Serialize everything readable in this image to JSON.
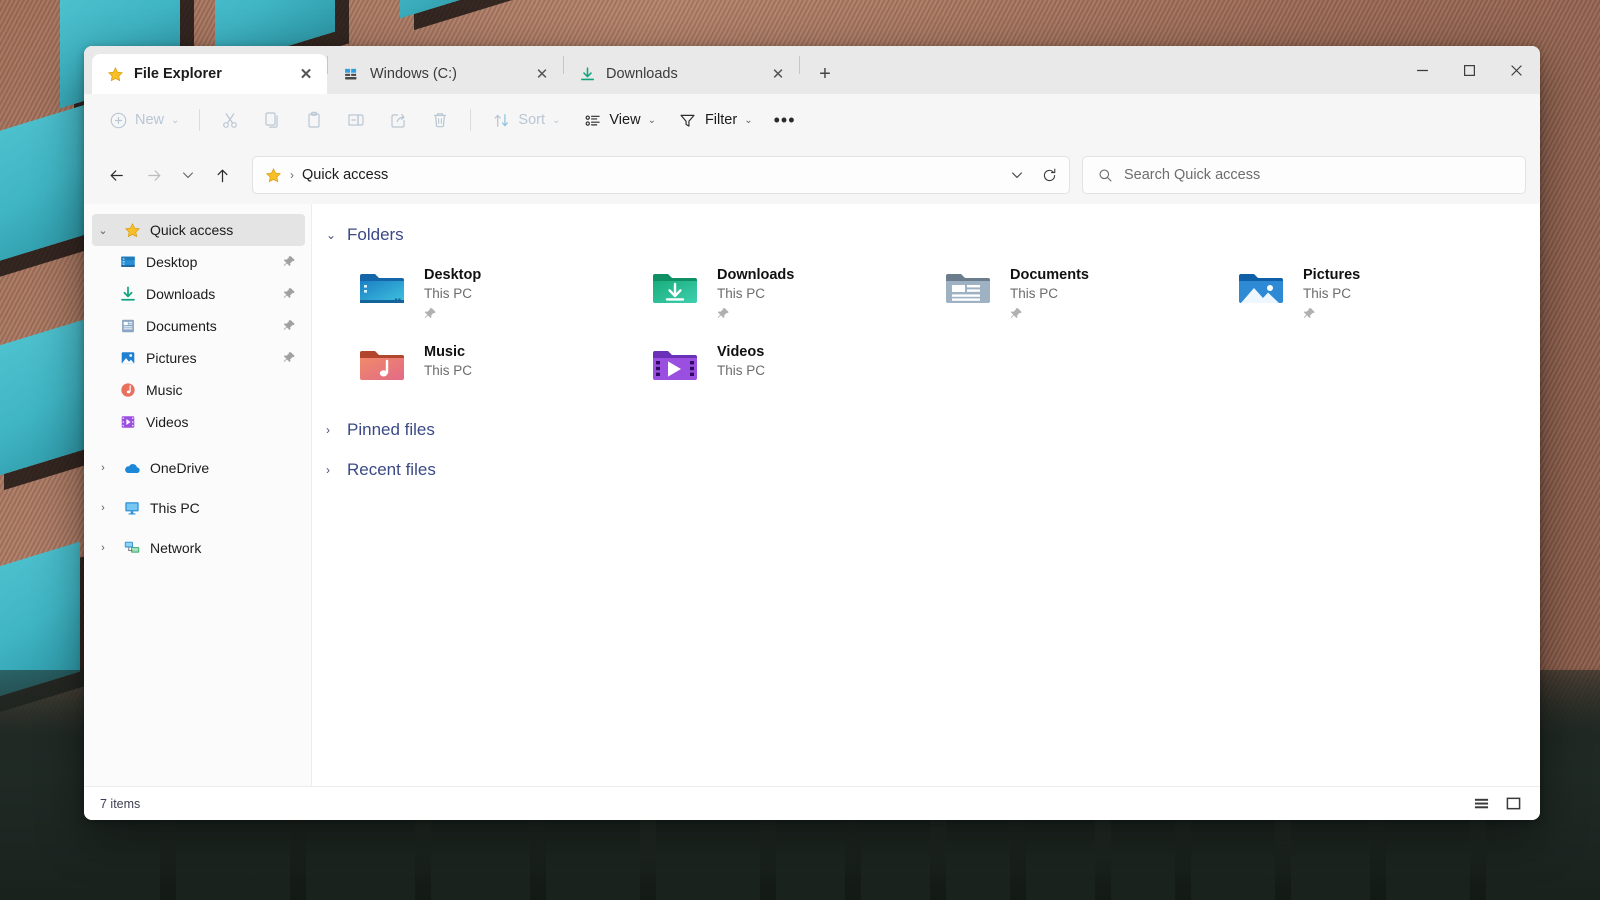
{
  "window": {
    "controls": {
      "minimize": "minimize-button",
      "maximize": "maximize-button",
      "close": "close-button"
    }
  },
  "tabs": [
    {
      "label": "File Explorer",
      "icon": "star-icon",
      "active": true,
      "close": "✕"
    },
    {
      "label": "Windows (C:)",
      "icon": "windows-drive-icon",
      "active": false,
      "close": "✕"
    },
    {
      "label": "Downloads",
      "icon": "download-icon",
      "active": false,
      "close": "✕"
    }
  ],
  "new_tab_label": "+",
  "toolbar": {
    "new_label": "New",
    "new_chevron": "⌄",
    "cut_label": "Cut",
    "copy_label": "Copy",
    "paste_label": "Paste",
    "rename_label": "Rename",
    "share_label": "Share",
    "delete_label": "Delete",
    "sort_label": "Sort",
    "sort_chevron": "⌄",
    "view_label": "View",
    "view_chevron": "⌄",
    "filter_label": "Filter",
    "filter_chevron": "⌄",
    "more_label": "•••"
  },
  "navigation": {
    "back": "back-button",
    "forward": "forward-button",
    "recent_chevron": "⌄",
    "up": "up-button"
  },
  "address": {
    "root_icon": "star-icon",
    "separator": "›",
    "path": "Quick access",
    "dropdown_chevron": "⌄",
    "refresh": "refresh-button"
  },
  "search": {
    "placeholder": "Search Quick access",
    "value": ""
  },
  "sidebar": {
    "items": [
      {
        "label": "Quick access",
        "icon": "star-icon",
        "twisty": "⌄",
        "indent": false,
        "selected": true,
        "pinned": false
      },
      {
        "label": "Desktop",
        "icon": "desktop-icon",
        "twisty": "",
        "indent": true,
        "selected": false,
        "pinned": true
      },
      {
        "label": "Downloads",
        "icon": "download-icon",
        "twisty": "",
        "indent": true,
        "selected": false,
        "pinned": true
      },
      {
        "label": "Documents",
        "icon": "documents-icon",
        "twisty": "",
        "indent": true,
        "selected": false,
        "pinned": true
      },
      {
        "label": "Pictures",
        "icon": "pictures-icon",
        "twisty": "",
        "indent": true,
        "selected": false,
        "pinned": true
      },
      {
        "label": "Music",
        "icon": "music-icon",
        "twisty": "",
        "indent": true,
        "selected": false,
        "pinned": false
      },
      {
        "label": "Videos",
        "icon": "videos-icon",
        "twisty": "",
        "indent": true,
        "selected": false,
        "pinned": false
      }
    ],
    "groups": [
      {
        "label": "OneDrive",
        "icon": "onedrive-icon",
        "twisty": "›"
      },
      {
        "label": "This PC",
        "icon": "thispc-icon",
        "twisty": "›"
      },
      {
        "label": "Network",
        "icon": "network-icon",
        "twisty": "›"
      }
    ]
  },
  "content": {
    "folders_section": {
      "label": "Folders",
      "chevron": "⌄",
      "expanded": true
    },
    "folders": [
      {
        "name": "Desktop",
        "sub": "This PC",
        "icon": "desktop-folder-icon",
        "pinned": true
      },
      {
        "name": "Downloads",
        "sub": "This PC",
        "icon": "downloads-folder-icon",
        "pinned": true
      },
      {
        "name": "Documents",
        "sub": "This PC",
        "icon": "documents-folder-icon",
        "pinned": true
      },
      {
        "name": "Pictures",
        "sub": "This PC",
        "icon": "pictures-folder-icon",
        "pinned": true
      },
      {
        "name": "Music",
        "sub": "This PC",
        "icon": "music-folder-icon",
        "pinned": false
      },
      {
        "name": "Videos",
        "sub": "This PC",
        "icon": "videos-folder-icon",
        "pinned": false
      }
    ],
    "pinned_files_section": {
      "label": "Pinned files",
      "chevron": "›",
      "expanded": false
    },
    "recent_files_section": {
      "label": "Recent files",
      "chevron": "›",
      "expanded": false
    }
  },
  "statusbar": {
    "item_count": "7 items",
    "details_view": "details-view-toggle",
    "large_icons_view": "large-icons-view-toggle"
  },
  "colors": {
    "accent_link": "#3b4a86",
    "star_gold": "#f6c026",
    "selected_bg": "#e4e4e4",
    "disabled": "#b9c6d4"
  }
}
